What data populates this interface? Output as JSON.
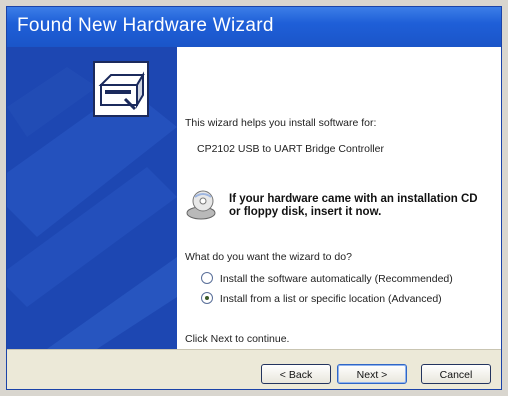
{
  "window": {
    "title": "Found New Hardware Wizard"
  },
  "content": {
    "intro": "This wizard helps you install software for:",
    "device_name": "CP2102 USB to UART Bridge Controller",
    "cd_notice": "If your hardware came with an installation CD or floppy disk, insert it now.",
    "question": "What do you want the wizard to do?",
    "options": [
      {
        "label": "Install the software automatically (Recommended)",
        "selected": false
      },
      {
        "label": "Install from a list or specific location (Advanced)",
        "selected": true
      }
    ],
    "continue_hint": "Click Next to continue."
  },
  "footer": {
    "back_label": "< Back",
    "next_label": "Next >",
    "cancel_label": "Cancel"
  },
  "colors": {
    "title_bar": "#1f5fd8",
    "side_panel": "#1d47b2",
    "footer": "#ece9d8"
  },
  "icons": {
    "hardware": "hardware-wizard-icon",
    "cd": "cd-drive-icon"
  }
}
